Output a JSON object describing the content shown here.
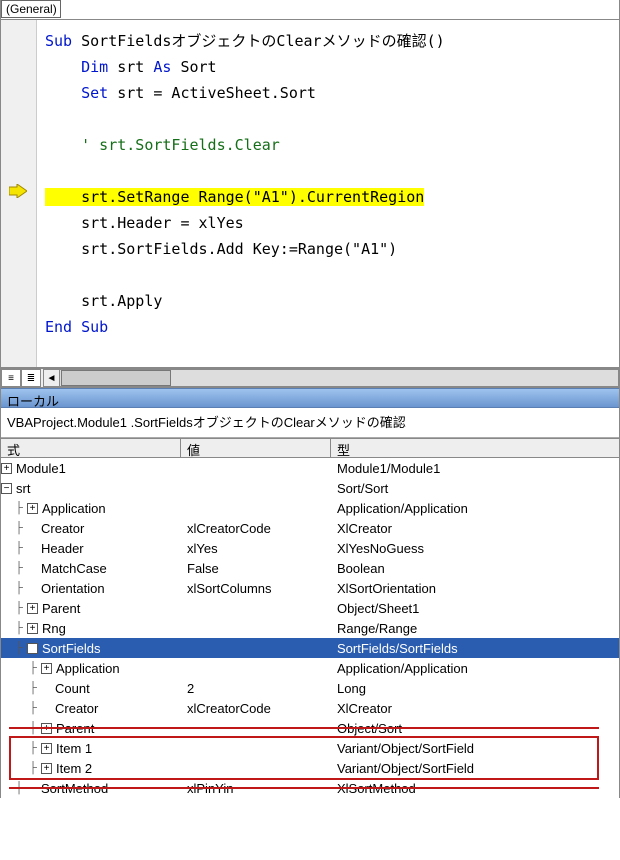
{
  "dropdowns": {
    "object": "(General)"
  },
  "code": {
    "l1a": "Sub",
    "l1b": " SortFieldsオブジェクトのClearメソッドの確認()",
    "l2a": "    Dim",
    "l2b": " srt ",
    "l2c": "As",
    "l2d": " Sort",
    "l3a": "    Set",
    "l3b": " srt = ActiveSheet.Sort",
    "l5": "    ' srt.SortFields.Clear",
    "l7": "    srt.SetRange Range(\"A1\").CurrentRegion",
    "l8": "    srt.Header = xlYes",
    "l9": "    srt.SortFields.Add Key:=Range(\"A1\")",
    "l11": "    srt.Apply",
    "l12": "End Sub"
  },
  "locals": {
    "panel_title": "ローカル",
    "context": "VBAProject.Module1 .SortFieldsオブジェクトのClearメソッドの確認",
    "headers": {
      "expr": "式",
      "value": "値",
      "type": "型"
    },
    "rows": [
      {
        "depth": 0,
        "toggle": "+",
        "name": "Module1",
        "value": "",
        "type": "Module1/Module1"
      },
      {
        "depth": 0,
        "toggle": "-",
        "name": "srt",
        "value": "",
        "type": "Sort/Sort"
      },
      {
        "depth": 1,
        "toggle": "+",
        "name": "Application",
        "value": "",
        "type": "Application/Application"
      },
      {
        "depth": 1,
        "toggle": null,
        "name": "Creator",
        "value": "xlCreatorCode",
        "type": "XlCreator"
      },
      {
        "depth": 1,
        "toggle": null,
        "name": "Header",
        "value": "xlYes",
        "type": "XlYesNoGuess"
      },
      {
        "depth": 1,
        "toggle": null,
        "name": "MatchCase",
        "value": "False",
        "type": "Boolean"
      },
      {
        "depth": 1,
        "toggle": null,
        "name": "Orientation",
        "value": "xlSortColumns",
        "type": "XlSortOrientation"
      },
      {
        "depth": 1,
        "toggle": "+",
        "name": "Parent",
        "value": "",
        "type": "Object/Sheet1"
      },
      {
        "depth": 1,
        "toggle": "+",
        "name": "Rng",
        "value": "",
        "type": "Range/Range"
      },
      {
        "depth": 1,
        "toggle": "-",
        "name": "SortFields",
        "value": "",
        "type": "SortFields/SortFields",
        "selected": true
      },
      {
        "depth": 2,
        "toggle": "+",
        "name": "Application",
        "value": "",
        "type": "Application/Application"
      },
      {
        "depth": 2,
        "toggle": null,
        "name": "Count",
        "value": "2",
        "type": "Long"
      },
      {
        "depth": 2,
        "toggle": null,
        "name": "Creator",
        "value": "xlCreatorCode",
        "type": "XlCreator"
      },
      {
        "depth": 2,
        "toggle": "+",
        "name": "Parent",
        "value": "",
        "type": "Object/Sort"
      },
      {
        "depth": 2,
        "toggle": "+",
        "name": "Item 1",
        "value": "",
        "type": "Variant/Object/SortField"
      },
      {
        "depth": 2,
        "toggle": "+",
        "name": "Item 2",
        "value": "",
        "type": "Variant/Object/SortField"
      },
      {
        "depth": 1,
        "toggle": null,
        "name": "SortMethod",
        "value": "xlPinYin",
        "type": "XlSortMethod"
      }
    ]
  }
}
